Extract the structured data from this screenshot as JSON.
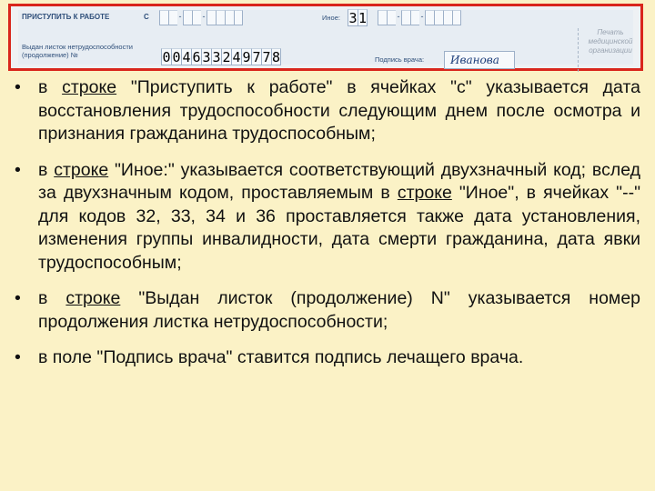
{
  "form": {
    "start_work_label": "ПРИСТУПИТЬ К РАБОТЕ",
    "start_work_from": "С",
    "issued_label_line1": "Выдан листок нетрудоспособности",
    "issued_label_line2": "(продолжение) №",
    "sheet_number_digits": [
      "0",
      "0",
      "4",
      "6",
      "3",
      "3",
      "2",
      "4",
      "9",
      "7",
      "7",
      "8"
    ],
    "other_label": "Иное:",
    "other_code_digits": [
      "3",
      "1"
    ],
    "doctor_signature_label": "Подпись врача:",
    "doctor_signature_value": "Иванова",
    "stamp_text": [
      "Печать",
      "медицинской",
      "организации"
    ]
  },
  "bullets": [
    {
      "mark": "•",
      "parts": [
        {
          "text": "в ",
          "u": false
        },
        {
          "text": "строке",
          "u": true
        },
        {
          "text": " \"Приступить к работе\" в ячейках \"с\" указывается дата восстановления трудоспособности следующим днем после осмотра и признания гражданина трудоспособным;",
          "u": false
        }
      ]
    },
    {
      "mark": "•",
      "parts": [
        {
          "text": "в ",
          "u": false
        },
        {
          "text": "строке",
          "u": true
        },
        {
          "text": " \"Иное:\" указывается соответствующий двухзначный код; вслед за двухзначным кодом, проставляемым в ",
          "u": false
        },
        {
          "text": "строке",
          "u": true
        },
        {
          "text": " \"Иное\", в ячейках \"--\" для кодов 32, 33, 34 и 36 проставляется также дата установления, изменения группы инвалидности, дата смерти гражданина, дата явки трудоспособным;",
          "u": false
        }
      ]
    },
    {
      "mark": "•",
      "parts": [
        {
          "text": "в ",
          "u": false
        },
        {
          "text": "строке",
          "u": true
        },
        {
          "text": " \"Выдан листок (продолжение) N\" указывается номер продолжения листка нетрудоспособности;",
          "u": false
        }
      ]
    },
    {
      "mark": "•",
      "parts": [
        {
          "text": "в поле \"Подпись врача\" ставится подпись лечащего врача.",
          "u": false
        }
      ]
    }
  ],
  "colors": {
    "background": "#fbf2c6",
    "form_border": "#d9261c",
    "form_label": "#2f4f7a"
  }
}
